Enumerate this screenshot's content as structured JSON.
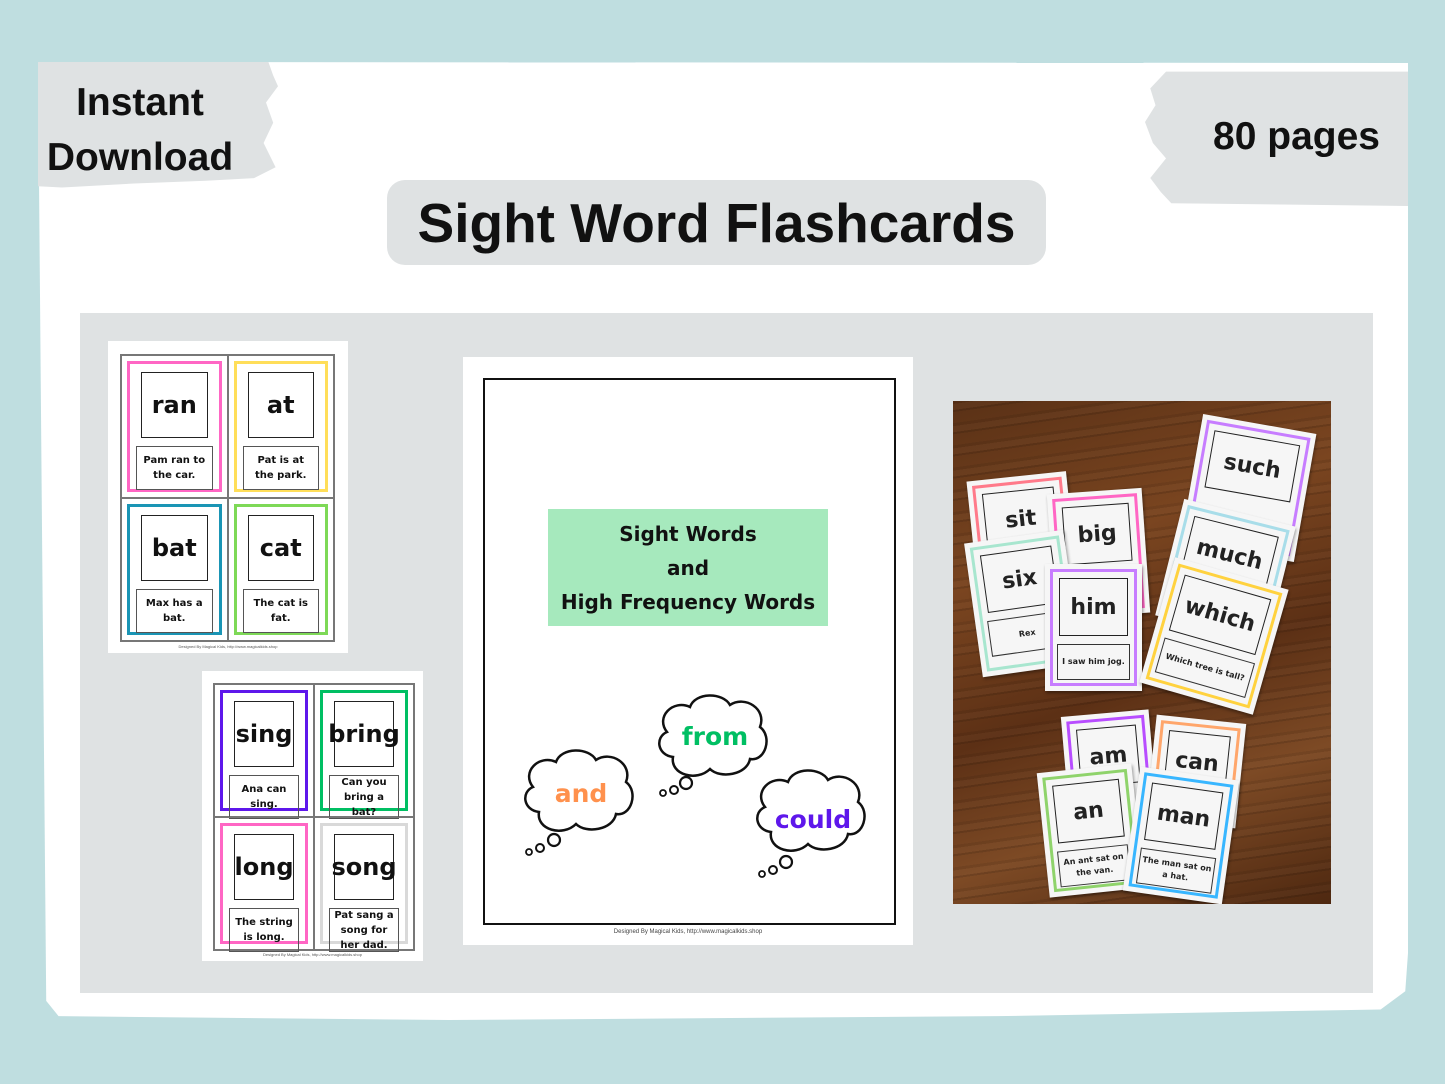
{
  "badges": {
    "left": [
      "Instant",
      "Download"
    ],
    "right": "80 pages"
  },
  "title": "Sight Word Flashcards",
  "colors": {
    "background": "#bfdee0",
    "panel": "#dfe2e3",
    "cover_green": "#a6e9bd"
  },
  "sheet1": {
    "credit": "Designed By Magical Kids, http://www.magicalkids.shop",
    "cards": [
      {
        "word": "ran",
        "sentence": "Pam ran to the car.",
        "color": "#ff66c4"
      },
      {
        "word": "at",
        "sentence": "Pat is at the park.",
        "color": "#ffde59"
      },
      {
        "word": "bat",
        "sentence": "Max has a bat.",
        "color": "#1a95b5"
      },
      {
        "word": "cat",
        "sentence": "The cat is fat.",
        "color": "#7ed957"
      }
    ]
  },
  "sheet2": {
    "credit": "Designed By Magical Kids, http://www.magicalkids.shop",
    "cards": [
      {
        "word": "sing",
        "sentence": "Ana can sing.",
        "color": "#5e17eb"
      },
      {
        "word": "bring",
        "sentence": "Can you bring a bat?",
        "color": "#00bf63"
      },
      {
        "word": "long",
        "sentence": "The string is long.",
        "color": "#ff66c4"
      },
      {
        "word": "song",
        "sentence": "Pat sang a song for her dad.",
        "color": "#d9d9d9"
      }
    ]
  },
  "cover": {
    "title_lines": [
      "Sight Words",
      "and",
      "High Frequency Words"
    ],
    "clouds": [
      {
        "word": "and",
        "color": "#ff914d"
      },
      {
        "word": "from",
        "color": "#00bf63"
      },
      {
        "word": "could",
        "color": "#5e17eb"
      }
    ],
    "credit": "Designed By Magical Kids, http://www.magicalkids.shop"
  },
  "photo": {
    "cards": [
      {
        "word": "sit",
        "sentence": "",
        "color": "#ff7a8a"
      },
      {
        "word": "big",
        "sentence": "",
        "color": "#ff66c4"
      },
      {
        "word": "six",
        "sentence": "Rex",
        "color": "#a8e6cf"
      },
      {
        "word": "him",
        "sentence": "I saw him jog.",
        "color": "#c77dff"
      },
      {
        "word": "such",
        "sentence": "",
        "color": "#c77dff"
      },
      {
        "word": "much",
        "sentence": "",
        "color": "#a8dde9"
      },
      {
        "word": "which",
        "sentence": "Which tree is tall?",
        "color": "#ffd23f"
      },
      {
        "word": "am",
        "sentence": "",
        "color": "#b84dff"
      },
      {
        "word": "can",
        "sentence": "",
        "color": "#ffa66b"
      },
      {
        "word": "an",
        "sentence": "An ant sat on the van.",
        "color": "#8fd36b"
      },
      {
        "word": "man",
        "sentence": "The man sat on a hat.",
        "color": "#38b6ff"
      }
    ]
  }
}
